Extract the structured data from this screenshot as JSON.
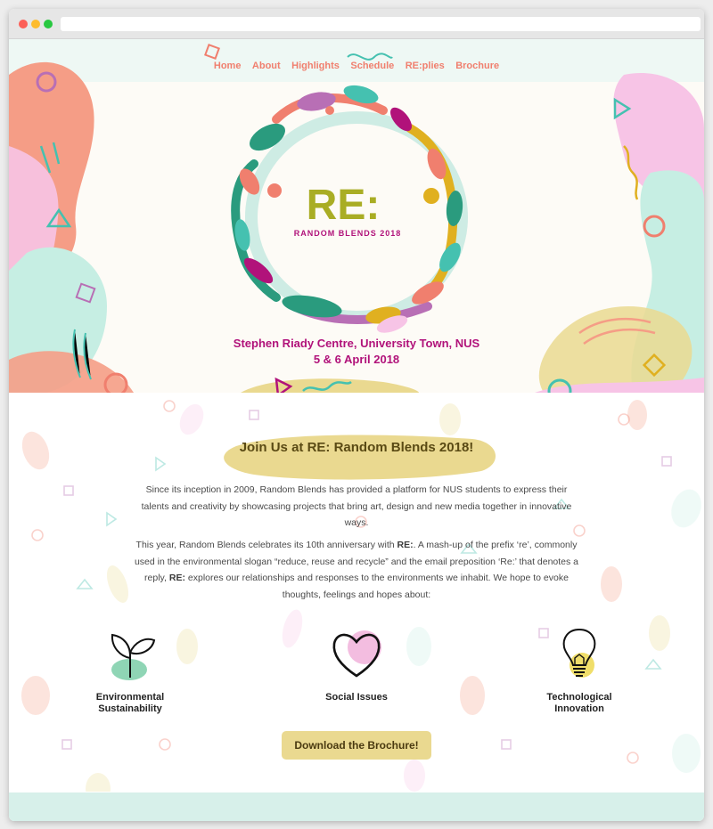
{
  "nav": {
    "items": [
      "Home",
      "About",
      "Highlights",
      "Schedule",
      "RE:plies",
      "Brochure"
    ]
  },
  "hero": {
    "logo_title": "RE:",
    "logo_subtitle": "RANDOM BLENDS 2018",
    "venue": "Stephen Riady Centre, University Town, NUS",
    "dates": "5 & 6 April 2018"
  },
  "intro": {
    "heading": "Join Us at RE: Random Blends 2018!",
    "para1": "Since its inception in 2009, Random Blends has provided a platform for NUS students to express their talents and creativity by showcasing projects that bring art, design and new media together in innovative ways.",
    "para2_a": "This year, Random Blends celebrates its 10th anniversary with ",
    "para2_b": "RE:",
    "para2_c": ". A mash-up of the prefix ‘re’, commonly used in the environmental slogan “reduce, reuse and recycle” and the email preposition ‘Re:’ that denotes a reply, ",
    "para2_d": "RE:",
    "para2_e": " explores our relationships and responses to the environments we inhabit. We hope to evoke thoughts, feelings and hopes about:"
  },
  "features": [
    {
      "label_line1": "Environmental",
      "label_line2": "Sustainability",
      "icon": "sprout-icon"
    },
    {
      "label_line1": "Social Issues",
      "label_line2": "",
      "icon": "heart-icon"
    },
    {
      "label_line1": "Technological",
      "label_line2": "Innovation",
      "icon": "lightbulb-icon"
    }
  ],
  "download_button": "Download the Brochure!",
  "colors": {
    "coral": "#f59d86",
    "pink": "#f7c4e6",
    "mint": "#c6eee3",
    "yellow": "#ead990",
    "magenta": "#b1127a",
    "olive": "#a9ad24",
    "teal": "#45c1b0"
  }
}
